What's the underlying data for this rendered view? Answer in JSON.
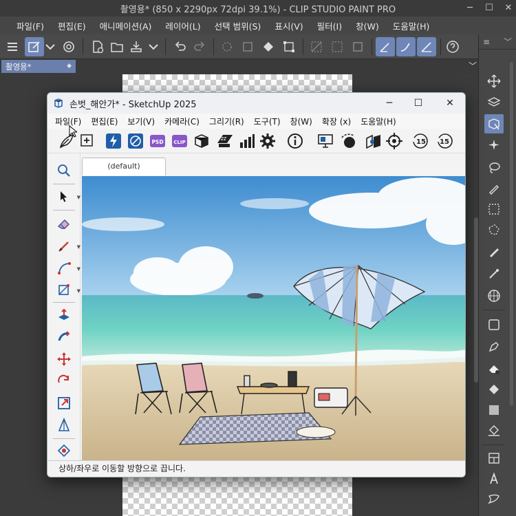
{
  "csp": {
    "title": "촬영용* (850 x 2290px 72dpi 39.1%)  - CLIP STUDIO PAINT PRO",
    "window_controls": [
      "─",
      "☐",
      "✕"
    ],
    "menu": [
      "파일(F)",
      "편집(E)",
      "애니메이션(A)",
      "레이어(L)",
      "선택 범위(S)",
      "표시(V)",
      "필터(I)",
      "창(W)",
      "도움말(H)"
    ],
    "tab_label": "촬영용*",
    "tab_dot": "◆",
    "tab_caret": "﹀",
    "rightpanel_caret": "﹀",
    "rightpanel_menu": "≡"
  },
  "sketchup": {
    "title": "손벗_해안가* - SketchUp 2025",
    "menu": [
      "파일(F)",
      "편집(E)",
      "보기(V)",
      "카메라(C)",
      "그리기(R)",
      "도구(T)",
      "창(W)",
      "확장 (x)",
      "도움말(H)"
    ],
    "window_controls": [
      "─",
      "☐",
      "✕"
    ],
    "toolbar_labels": {
      "psd": "PSD",
      "clip": "CLIP",
      "num15a": "15",
      "num15b": "15"
    },
    "scene_tab": "(default)",
    "status": "상하/좌우로 이동할 방향으로 끕니다."
  },
  "colors": {
    "csp_accent": "#6e86b8",
    "psd_purple": "#8a57c8",
    "sketchup_blue": "#1f5ea8",
    "sky": "#4e9bd6",
    "sea": "#5cc4be",
    "sand": "#d9c7a3"
  },
  "icons": {
    "csp_toolbar": [
      "menu-icon",
      "canvas-new-icon",
      "caret-icon",
      "swirl-icon",
      "new-file-icon",
      "open-folder-icon",
      "save-icon",
      "caret-icon",
      "undo-icon",
      "redo-icon",
      "brightness-icon",
      "fill-disabled-icon",
      "fill-bucket-icon",
      "transform-icon",
      "deselect-icon",
      "invert-icon",
      "crop-icon",
      "pen-ruler-icon",
      "pencil-ruler-icon",
      "ruler-icon",
      "help-icon"
    ],
    "csp_right": [
      "move-icon",
      "layer-move-icon",
      "object-icon",
      "magic-wand-icon",
      "lasso-icon",
      "select-pen-icon",
      "rect-select-icon",
      "poly-select-icon",
      "pen-icon",
      "airbrush-icon",
      "grid-icon",
      "square-icon",
      "pen-tool-icon",
      "eraser-icon",
      "fill-icon",
      "gradient-icon",
      "fill-bucket-icon",
      "panel-icon",
      "text-icon",
      "balloon-icon"
    ]
  }
}
